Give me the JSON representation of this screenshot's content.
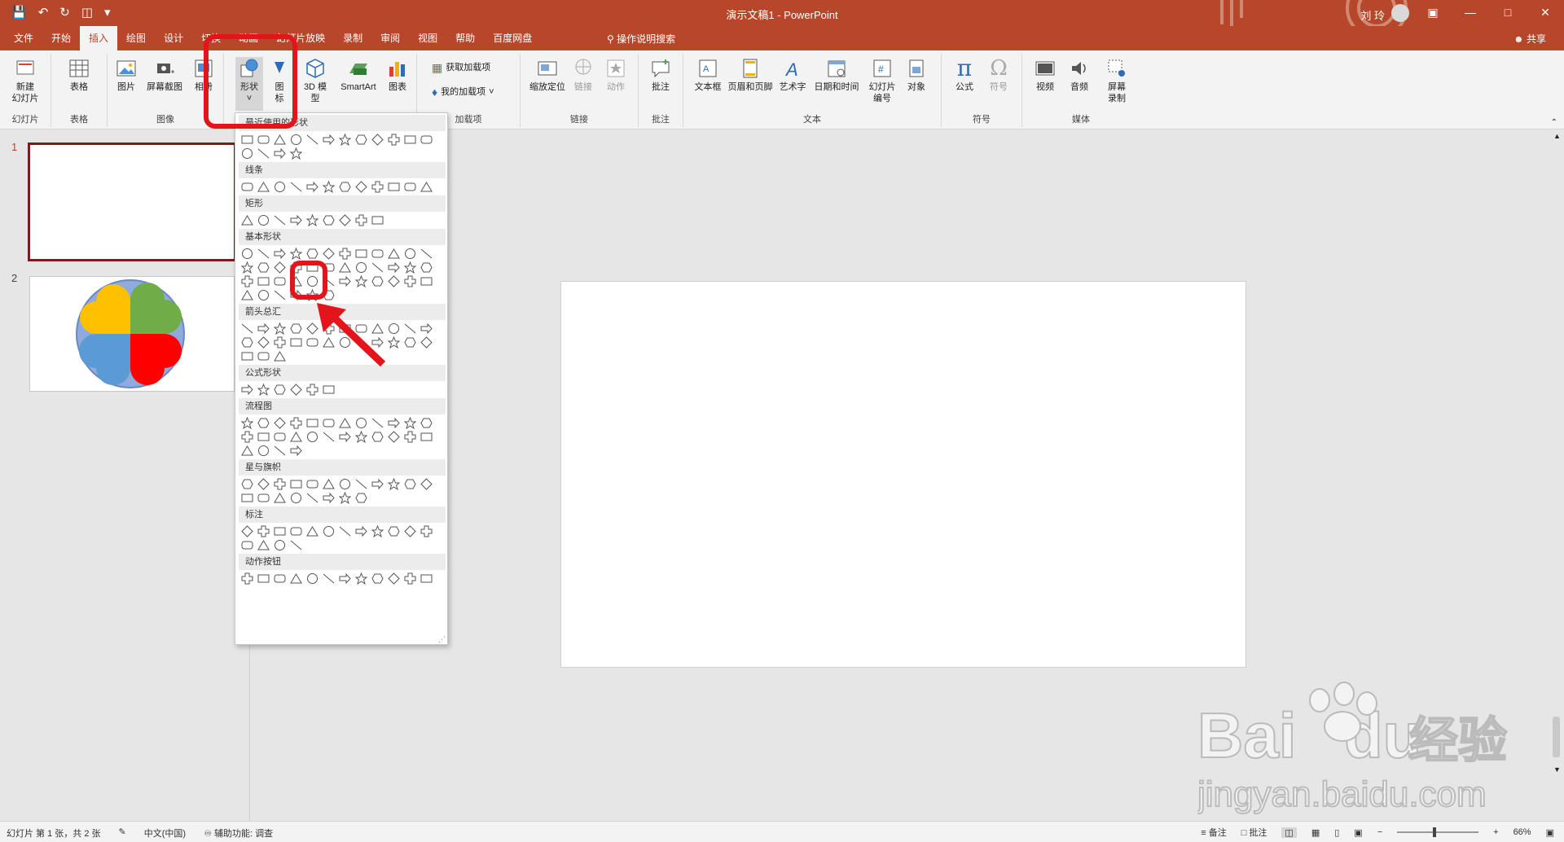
{
  "window": {
    "title": "演示文稿1  -  PowerPoint",
    "user": "刘 玲"
  },
  "menu": {
    "tabs": [
      "文件",
      "开始",
      "插入",
      "绘图",
      "设计",
      "切换",
      "动画",
      "幻灯片放映",
      "录制",
      "审阅",
      "视图",
      "帮助",
      "百度网盘"
    ],
    "active": "插入",
    "tell_me": "操作说明搜索",
    "share": "共享"
  },
  "ribbon": {
    "groups": [
      {
        "label": "幻灯片",
        "buttons": [
          "新建\n幻灯片"
        ]
      },
      {
        "label": "表格",
        "buttons": [
          "表格"
        ]
      },
      {
        "label": "图像",
        "buttons": [
          "图片",
          "屏幕截图",
          "相册"
        ]
      },
      {
        "label": "",
        "buttons": [
          "形状",
          "图标",
          "3D 模型",
          "SmartArt",
          "图表"
        ]
      },
      {
        "label": "加载项",
        "buttons": [
          "获取加载项",
          "我的加载项"
        ]
      },
      {
        "label": "链接",
        "buttons": [
          "缩放定位",
          "链接",
          "动作"
        ]
      },
      {
        "label": "批注",
        "buttons": [
          "批注"
        ]
      },
      {
        "label": "文本",
        "buttons": [
          "文本框",
          "页眉和页脚",
          "艺术字",
          "日期和时间",
          "幻灯片编号",
          "对象"
        ]
      },
      {
        "label": "符号",
        "buttons": [
          "公式",
          "符号"
        ]
      },
      {
        "label": "媒体",
        "buttons": [
          "视频",
          "音频",
          "屏幕录制"
        ]
      }
    ]
  },
  "shapes_menu": {
    "sections": [
      "最近使用的形状",
      "线条",
      "矩形",
      "基本形状",
      "箭头总汇",
      "公式形状",
      "流程图",
      "星与旗帜",
      "标注",
      "动作按钮"
    ]
  },
  "slides": [
    {
      "num": "1"
    },
    {
      "num": "2"
    }
  ],
  "colors": {
    "accent": "#b7472a",
    "clover_yellow": "#ffc000",
    "clover_green": "#70ad47",
    "clover_blue": "#5b9bd5",
    "clover_red": "#ff0000",
    "circle": "#8faadc",
    "highlight": "#e4141b"
  },
  "status": {
    "slide_info": "幻灯片 第 1 张，共 2 张",
    "language": "中文(中国)",
    "accessibility": "辅助功能: 调查",
    "notes": "备注",
    "comments": "批注",
    "zoom": "66%"
  },
  "watermark": {
    "brand": "Bai",
    "brand2": "du",
    "cn": "经验",
    "url": "jingyan.baidu.com"
  }
}
